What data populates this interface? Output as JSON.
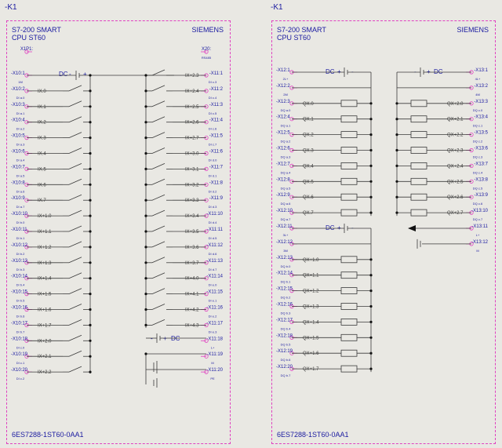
{
  "left": {
    "tag": "-K1",
    "title1": "S7-200 SMART",
    "title2": "CPU ST60",
    "brand": "SIEMENS",
    "order": "6ES7288-1ST60-0AA1",
    "top_terms": [
      {
        "t": "X1P1:",
        "s": "",
        "label": ""
      },
      {
        "t": "X20:",
        "s": "RS485",
        "label": ""
      }
    ],
    "dc_label": "DC",
    "dc_minus": "-",
    "dc_plus": "+",
    "dc_bottom": "DC",
    "dc_bottom_minus": "-",
    "dc_bottom_plus": "+",
    "left_terms": [
      {
        "t": "-X10:1",
        "s": "1M"
      },
      {
        "t": "-X10:2",
        "s": "DI a.0"
      },
      {
        "t": "-X10:3",
        "s": "DI a.1"
      },
      {
        "t": "-X10:4",
        "s": "DI a.2"
      },
      {
        "t": "-X10:5",
        "s": "DI a.3"
      },
      {
        "t": "-X10:6",
        "s": "DI a.4"
      },
      {
        "t": "-X10:7",
        "s": "DI a.5"
      },
      {
        "t": "-X10:8",
        "s": "DI a.6"
      },
      {
        "t": "-X10:9",
        "s": "DI a.7"
      },
      {
        "t": "-X10:10",
        "s": "DI b.0"
      },
      {
        "t": "-X10:11",
        "s": "DI b.1"
      },
      {
        "t": "-X10:12",
        "s": "DI b.2"
      },
      {
        "t": "-X10:13",
        "s": "DI b.3"
      },
      {
        "t": "-X10:14",
        "s": "DI b.4"
      },
      {
        "t": "-X10:15",
        "s": "DI b.5"
      },
      {
        "t": "-X10:16",
        "s": "DI b.6"
      },
      {
        "t": "-X10:17",
        "s": "DI b.7"
      },
      {
        "t": "-X10:18",
        "s": "DI c.0"
      },
      {
        "t": "-X10:19",
        "s": "DI c.1"
      },
      {
        "t": "-X10:20",
        "s": "DI c.2"
      }
    ],
    "left_inputs": [
      "IX.0",
      "IX.1",
      "IX.2",
      "IX.3",
      "IX.4",
      "IX.5",
      "IX.6",
      "IX.7",
      "IX+1.0",
      "IX+1.1",
      "IX+1.2",
      "IX+1.3",
      "IX+1.4",
      "IX+1.5",
      "IX+1.6",
      "IX+1.7",
      "IX+2.0",
      "IX+2.1",
      "IX+2.2"
    ],
    "right_terms": [
      {
        "t": "-X11:1",
        "s": "DI c.3"
      },
      {
        "t": "-X11:2",
        "s": "DI c.4"
      },
      {
        "t": "-X11:3",
        "s": "DI c.5"
      },
      {
        "t": "-X11:4",
        "s": "DI c.6"
      },
      {
        "t": "-X11:5",
        "s": "DI c.7"
      },
      {
        "t": "-X11:6",
        "s": "DI d.0"
      },
      {
        "t": "-X11:7",
        "s": "DI d.1"
      },
      {
        "t": "-X11:8",
        "s": "DI d.2"
      },
      {
        "t": "-X11:9",
        "s": "DI d.3"
      },
      {
        "t": "-X11:10",
        "s": "DI d.4"
      },
      {
        "t": "-X11:11",
        "s": "DI d.5"
      },
      {
        "t": "-X11:12",
        "s": "DI d.6"
      },
      {
        "t": "-X11:13",
        "s": "DI d.7"
      },
      {
        "t": "-X11:14",
        "s": "DI e.0"
      },
      {
        "t": "-X11:15",
        "s": "DI e.1"
      },
      {
        "t": "-X11:16",
        "s": "DI e.2"
      },
      {
        "t": "-X11:17",
        "s": "DI e.3"
      },
      {
        "t": "-X11:18",
        "s": "L+"
      },
      {
        "t": "-X11:19",
        "s": "M"
      },
      {
        "t": "-X11:20",
        "s": "PE"
      }
    ],
    "right_inputs": [
      "IX+2.3",
      "IX+2.4",
      "IX+2.5",
      "IX+2.6",
      "IX+2.7",
      "IX+3.0",
      "IX+3.1",
      "IX+3.2",
      "IX+3.3",
      "IX+3.4",
      "IX+3.5",
      "IX+3.6",
      "IX+3.7",
      "IX+4.0",
      "IX+4.1",
      "IX+4.2",
      "IX+4.3"
    ]
  },
  "right": {
    "tag": "-K1",
    "title1": "S7-200 SMART",
    "title2": "CPU ST60",
    "brand": "SIEMENS",
    "order": "6ES7288-1ST60-0AA1",
    "dc1": "DC",
    "dc1_plus": "+",
    "dc1_minus": "-",
    "dc2": "DC",
    "dc2_plus": "+",
    "dc2_minus": "-",
    "dc3": "DC",
    "dc3_plus": "+",
    "dc3_minus": "-",
    "left_terms": [
      {
        "t": "-X12:1",
        "s": "2L+"
      },
      {
        "t": "-X12:2",
        "s": "2M"
      },
      {
        "t": "-X12:3",
        "s": "DQ a.0"
      },
      {
        "t": "-X12:4",
        "s": "DQ a.1"
      },
      {
        "t": "-X12:5",
        "s": "DQ a.2"
      },
      {
        "t": "-X12:6",
        "s": "DQ a.3"
      },
      {
        "t": "-X12:7",
        "s": "DQ a.4"
      },
      {
        "t": "-X12:8",
        "s": "DQ a.5"
      },
      {
        "t": "-X12:9",
        "s": "DQ a.6"
      },
      {
        "t": "-X12:10",
        "s": "DQ a.7"
      },
      {
        "t": "-X12:11",
        "s": "3L+"
      },
      {
        "t": "-X12:12",
        "s": "3M"
      },
      {
        "t": "-X12:13",
        "s": "DQ b.0"
      },
      {
        "t": "-X12:14",
        "s": "DQ b.1"
      },
      {
        "t": "-X12:15",
        "s": "DQ b.2"
      },
      {
        "t": "-X12:16",
        "s": "DQ b.3"
      },
      {
        "t": "-X12:17",
        "s": "DQ b.4"
      },
      {
        "t": "-X12:18",
        "s": "DQ b.5"
      },
      {
        "t": "-X12:19",
        "s": "DQ b.6"
      },
      {
        "t": "-X12:20",
        "s": "DQ b.7"
      }
    ],
    "left_outputs": [
      "QX.0",
      "QX.1",
      "QX.2",
      "QX.3",
      "QX.4",
      "QX.5",
      "QX.6",
      "QX.7",
      "QX+1.0",
      "QX+1.1",
      "QX+1.2",
      "QX+1.3",
      "QX+1.4",
      "QX+1.5",
      "QX+1.6",
      "QX+1.7"
    ],
    "right_terms": [
      {
        "t": "-X13:1",
        "s": "4L+"
      },
      {
        "t": "-X13:2",
        "s": "4M"
      },
      {
        "t": "-X13:3",
        "s": "DQ c.0"
      },
      {
        "t": "-X13:4",
        "s": "DQ c.1"
      },
      {
        "t": "-X13:5",
        "s": "DQ c.2"
      },
      {
        "t": "-X13:6",
        "s": "DQ c.3"
      },
      {
        "t": "-X13:7",
        "s": "DQ c.4"
      },
      {
        "t": "-X13:8",
        "s": "DQ c.5"
      },
      {
        "t": "-X13:9",
        "s": "DQ c.6"
      },
      {
        "t": "-X13:10",
        "s": "DQ c.7"
      },
      {
        "t": "-X13:11",
        "s": "L+"
      },
      {
        "t": "-X13:12",
        "s": "M"
      }
    ],
    "right_outputs": [
      "QX+2.0",
      "QX+2.1",
      "QX+2.2",
      "QX+2.3",
      "QX+2.4",
      "QX+2.5",
      "QX+2.6",
      "QX+2.7"
    ]
  }
}
